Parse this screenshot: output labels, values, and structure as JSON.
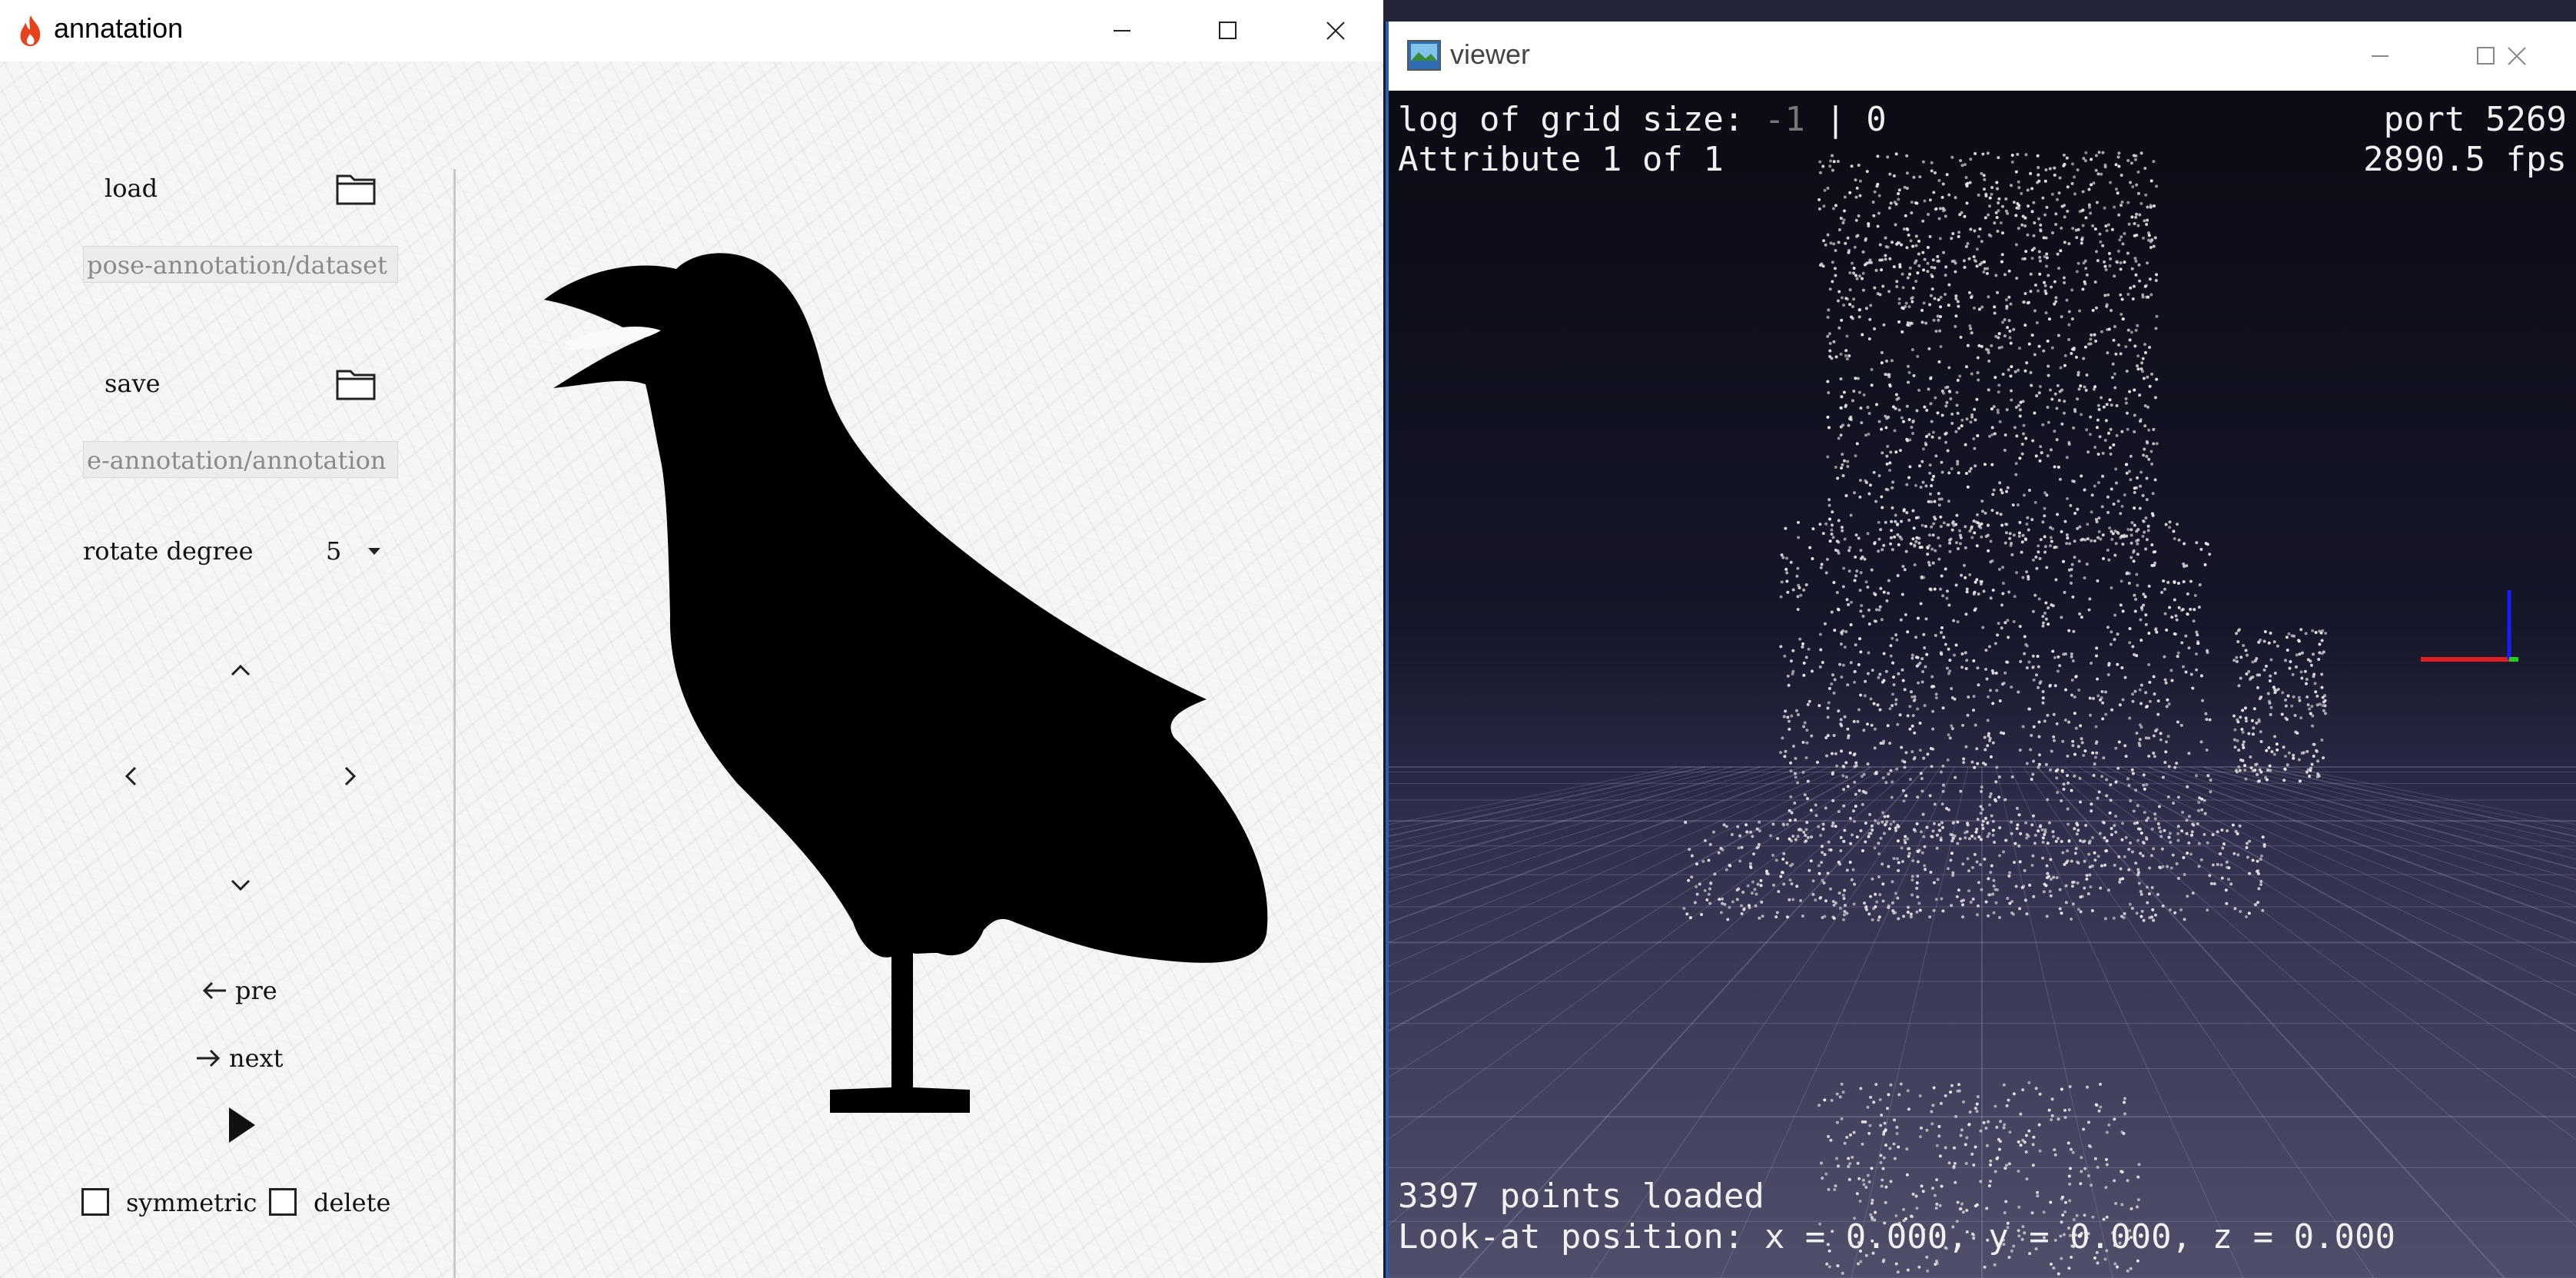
{
  "annotation_window": {
    "title": "annatation",
    "controls": {
      "load_label": "load",
      "load_path": "pose-annotation/dataset",
      "save_label": "save",
      "save_path": "e-annotation/annotation",
      "rotate_label": "rotate degree",
      "rotate_value": "5",
      "pre_label": "pre",
      "next_label": "next",
      "symmetric_label": "symmetric",
      "delete_label": "delete",
      "symmetric_checked": false,
      "delete_checked": false
    },
    "icons": [
      "flame-icon",
      "minimize-icon",
      "maximize-icon",
      "close-icon",
      "folder-icon",
      "chevron-up-icon",
      "chevron-left-icon",
      "chevron-right-icon",
      "chevron-down-icon",
      "arrow-left-icon",
      "arrow-right-icon",
      "play-icon"
    ]
  },
  "viewer_window": {
    "title": "viewer",
    "hud": {
      "grid_label": "log of grid size: ",
      "grid_value_a": "-1",
      "grid_sep": " | ",
      "grid_value_b": "0",
      "port": "port 5269",
      "attribute": "Attribute 1 of 1",
      "fps": "2890.5 fps",
      "points_loaded": "3397 points loaded",
      "look_at": "Look-at position: x = 0.000, y = 0.000, z = 0.000"
    },
    "colors": {
      "axis_x": "#e02020",
      "axis_y": "#1a1aff",
      "axis_z": "#20d020",
      "points": "#e8e8e8"
    }
  }
}
